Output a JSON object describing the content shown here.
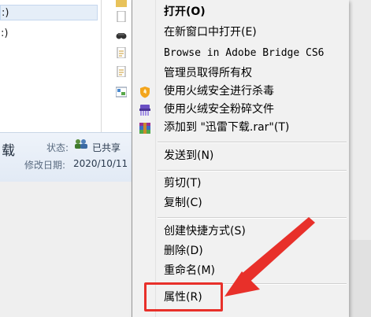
{
  "nav_pane": {
    "items": [
      {
        "label": ":)",
        "selected": true
      },
      {
        "label": ":)",
        "selected": false
      }
    ]
  },
  "file_pane": {
    "icons": [
      "folder-icon",
      "blank-file-icon",
      "binoculars-icon",
      "document-icon",
      "document-icon",
      "image-file-icon"
    ]
  },
  "details": {
    "name": "载",
    "status_label": "状态:",
    "status_value": "已共享",
    "modified_label": "修改日期:",
    "modified_value": "2020/10/11"
  },
  "context_menu": {
    "items": [
      {
        "label": "打开(O)",
        "bold": true,
        "icon": ""
      },
      {
        "label": "在新窗口中打开(E)",
        "icon": ""
      },
      {
        "label": "Browse in Adobe Bridge CS6",
        "mono": true,
        "icon": ""
      },
      {
        "label": "管理员取得所有权",
        "icon": ""
      },
      {
        "label": "使用火绒安全进行杀毒",
        "icon": "huorong-shield-icon"
      },
      {
        "label": "使用火绒安全粉碎文件",
        "icon": "huorong-shredder-icon"
      },
      {
        "label": "添加到 \"迅雷下载.rar\"(T)",
        "icon": "winrar-icon"
      },
      {
        "label": "发送到(N)",
        "icon": ""
      },
      {
        "label": "剪切(T)",
        "icon": ""
      },
      {
        "label": "复制(C)",
        "icon": ""
      },
      {
        "label": "创建快捷方式(S)",
        "icon": ""
      },
      {
        "label": "删除(D)",
        "icon": ""
      },
      {
        "label": "重命名(M)",
        "icon": ""
      },
      {
        "label": "属性(R)",
        "icon": ""
      }
    ]
  },
  "annotation": {
    "color": "#e8302a"
  }
}
